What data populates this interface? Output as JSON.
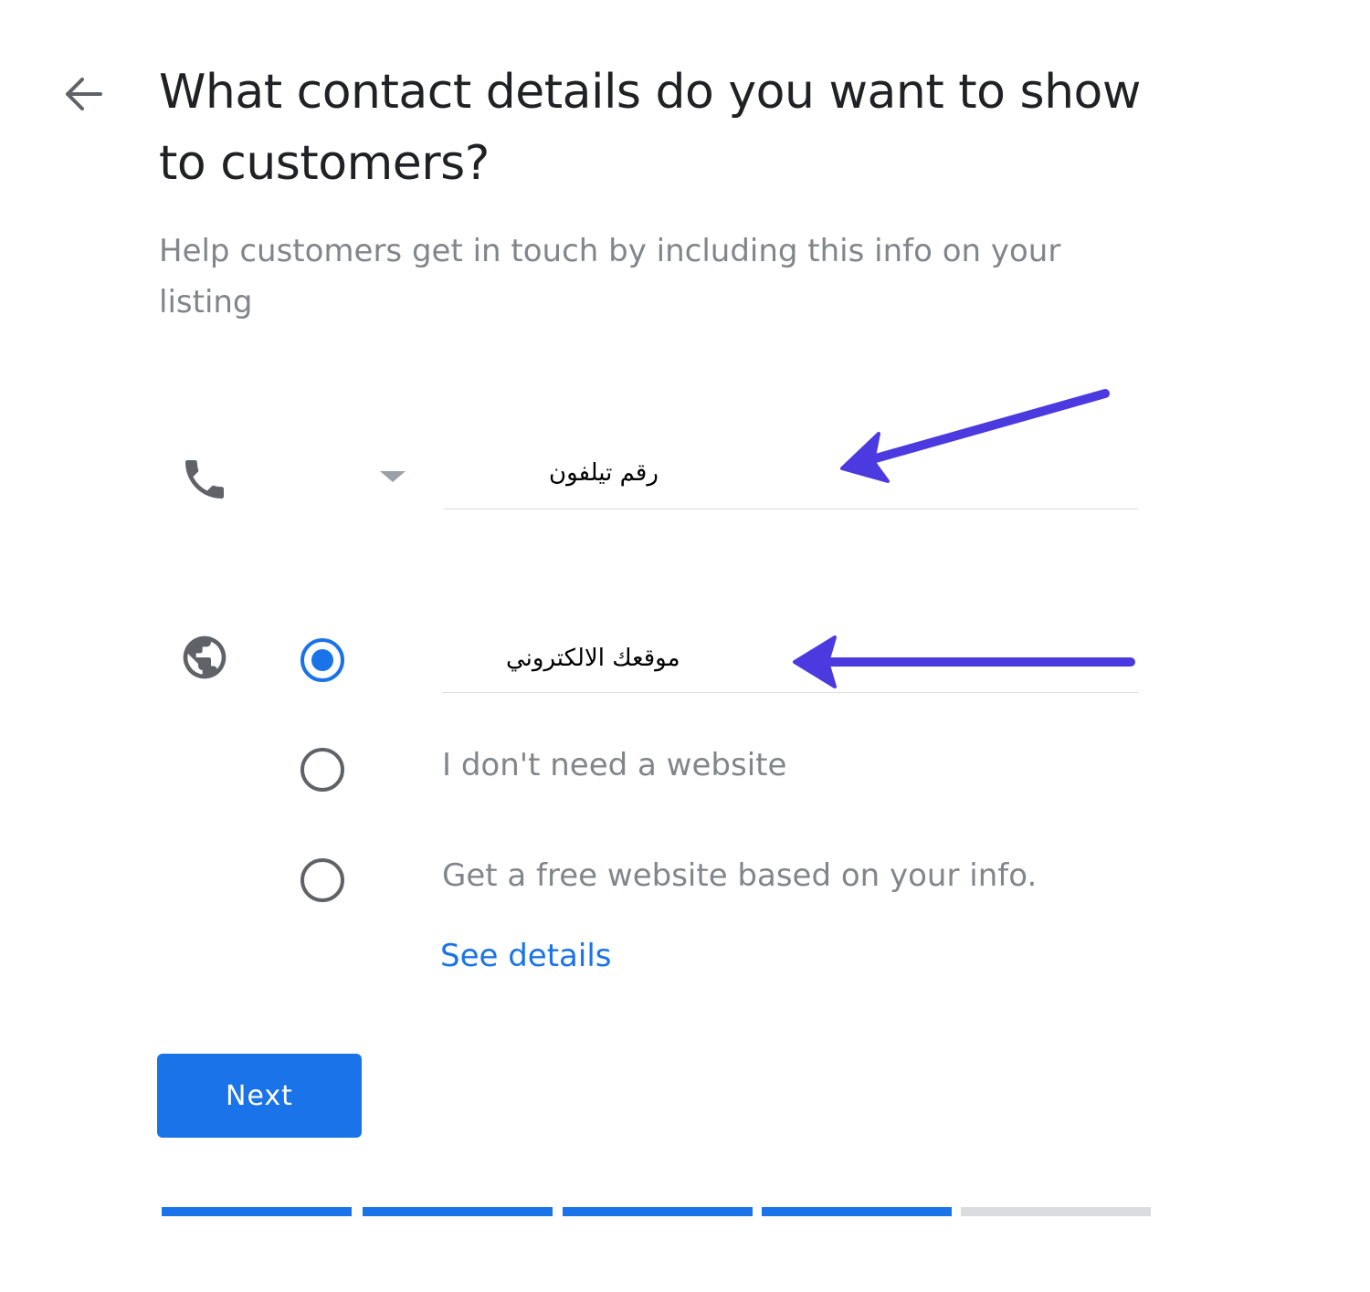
{
  "header": {
    "back_label": "←",
    "title": "What contact details do you want to show to customers?",
    "subtitle": "Help customers get in touch by including this info on your listing"
  },
  "phone": {
    "icon": "phone-icon",
    "annotation": "رقم تيلفون"
  },
  "website": {
    "icon": "globe-icon",
    "annotation": "موقعك الالكتروني",
    "options": [
      {
        "label": "",
        "selected": true
      },
      {
        "label": "I don't need a website",
        "selected": false
      },
      {
        "label": "Get a free website based on your info.",
        "selected": false
      }
    ],
    "see_details": "See details"
  },
  "actions": {
    "next_label": "Next"
  },
  "progress": {
    "steps_total": 5,
    "steps_completed": 4
  },
  "colors": {
    "accent": "#1a73e8",
    "title_text": "#202124",
    "secondary_text": "#80868b",
    "progress_inactive": "#dadce0",
    "annotation_arrow": "#4b3adf"
  }
}
